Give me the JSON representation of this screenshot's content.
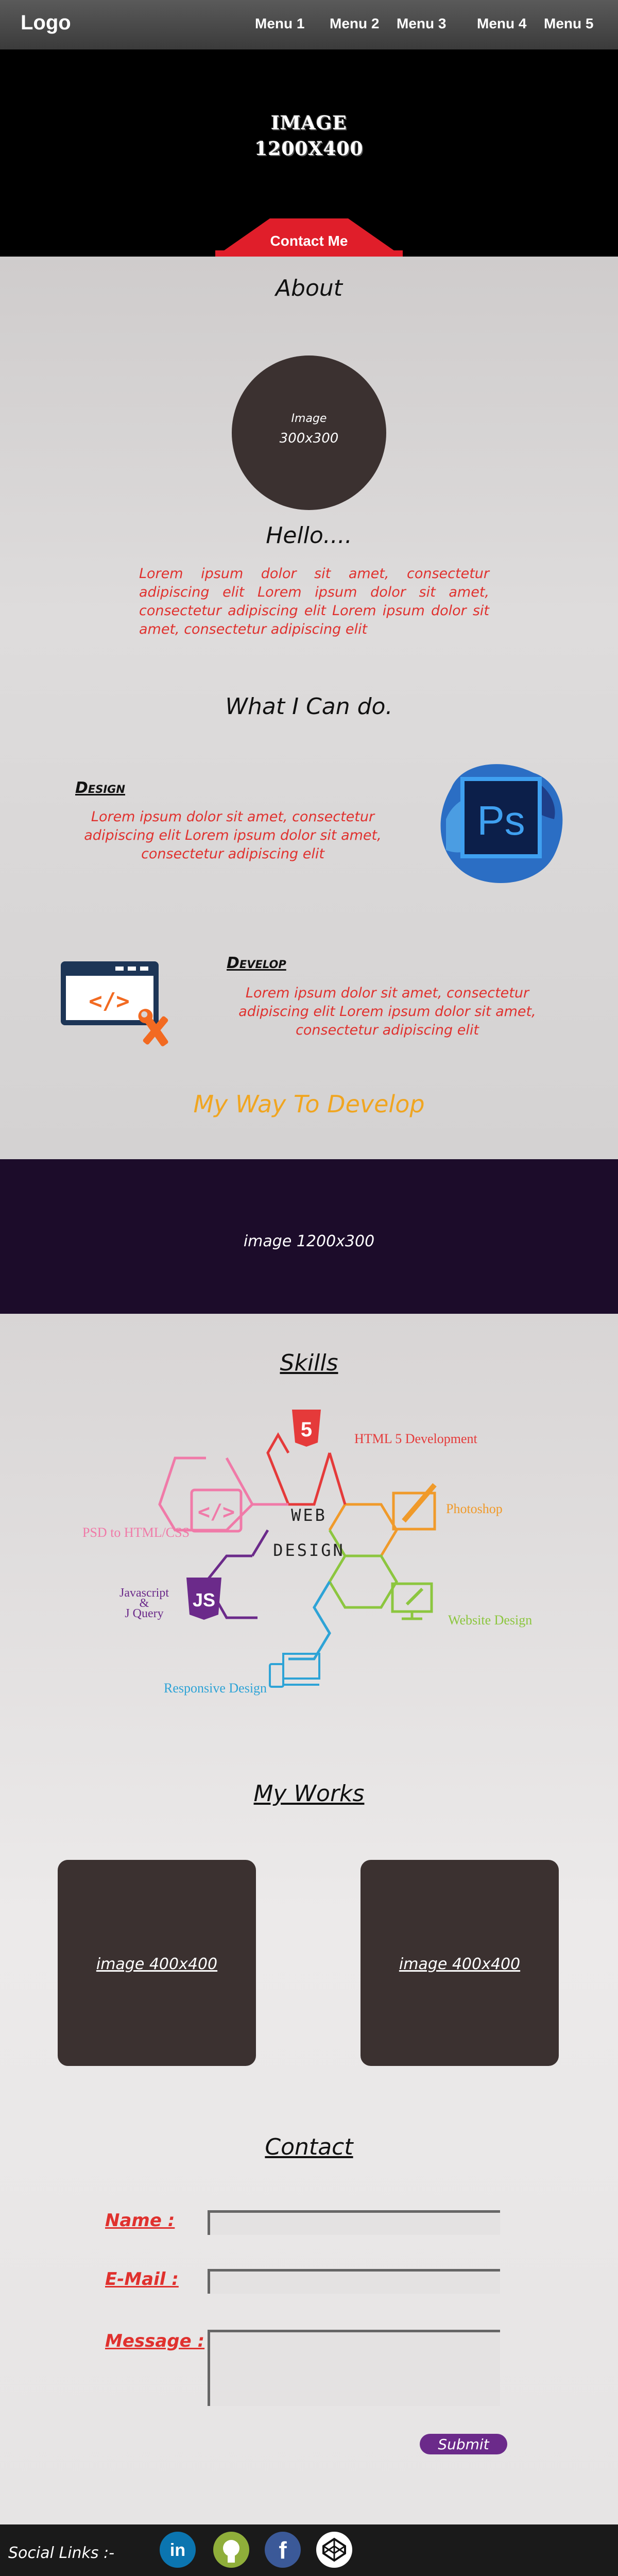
{
  "header": {
    "logo": "Logo",
    "menu": [
      "Menu 1",
      "Menu 2",
      "Menu 3",
      "Menu 4",
      "Menu 5"
    ]
  },
  "hero": {
    "label_line1": "IMAGE",
    "label_line2": "1200X400",
    "contact_button": "Contact Me"
  },
  "about": {
    "title": "About",
    "image_line1": "Image",
    "image_line2": "300x300",
    "greeting": "Hello....",
    "text": "Lorem ipsum dolor sit amet, consectetur adipiscing elit Lorem ipsum dolor sit amet, consectetur adipiscing elit Lorem ipsum dolor sit amet, consectetur adipiscing elit"
  },
  "capabilities": {
    "title": "What I Can do.",
    "design": {
      "title": "Design",
      "text": "Lorem ipsum dolor sit amet, consectetur adipiscing elit Lorem ipsum dolor sit amet, consectetur adipiscing elit",
      "icon": "photoshop-icon"
    },
    "develop": {
      "title": "Develop",
      "text": "Lorem ipsum dolor sit amet, consectetur adipiscing elit Lorem ipsum dolor sit amet, consectetur adipiscing elit",
      "icon": "code-window-icon"
    },
    "tagline": "My Way To Develop"
  },
  "banner": {
    "label": "image 1200x300"
  },
  "skills": {
    "title": "Skills",
    "center_line1": "WEB",
    "center_line2": "DESIGN",
    "items": [
      {
        "label": "HTML 5 Development",
        "color": "#e53a3a"
      },
      {
        "label": "Photoshop",
        "color": "#f09a2a"
      },
      {
        "label": "Website Design",
        "color": "#8cc63f"
      },
      {
        "label": "Responsive Design",
        "color": "#2ea3d6"
      },
      {
        "label": "Javascript",
        "label2": "&",
        "label3": "J Query",
        "color": "#6b2a8a"
      },
      {
        "label": "PSD to HTML/CSS",
        "color": "#f07aa8"
      }
    ]
  },
  "works": {
    "title": "My Works",
    "items": [
      "image 400x400",
      "image 400x400"
    ]
  },
  "contact": {
    "title": "Contact",
    "name_label": "Name :",
    "email_label": "E-Mail :",
    "message_label": "Message :",
    "submit": "Submit"
  },
  "footer": {
    "social_label": "Social Links :-",
    "icons": [
      "linkedin-icon",
      "github-icon",
      "facebook-icon",
      "codepen-icon"
    ]
  },
  "colors": {
    "accent_red": "#e0312e",
    "orange": "#f0a520",
    "banner": "#1c0c2a",
    "submit": "#6b2a8a"
  }
}
